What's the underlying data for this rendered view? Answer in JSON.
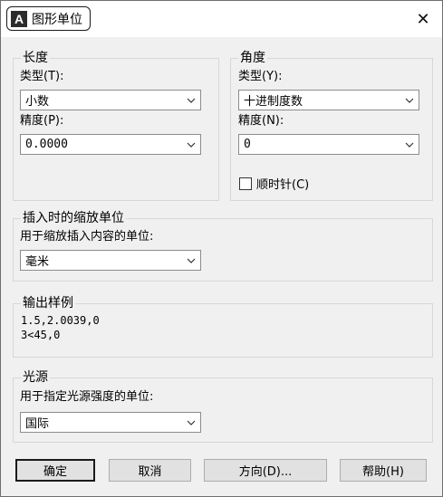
{
  "window": {
    "icon_letter": "A",
    "title": "图形单位",
    "close_symbol": "✕"
  },
  "length": {
    "legend": "长度",
    "type_label": "类型(T):",
    "type_value": "小数",
    "precision_label": "精度(P):",
    "precision_value": "0.0000"
  },
  "angle": {
    "legend": "角度",
    "type_label": "类型(Y):",
    "type_value": "十进制度数",
    "precision_label": "精度(N):",
    "precision_value": "0",
    "clockwise_label": "顺时针(C)",
    "clockwise_checked": false
  },
  "insertion": {
    "legend": "插入时的缩放单位",
    "label": "用于缩放插入内容的单位:",
    "value": "毫米"
  },
  "sample": {
    "legend": "输出样例",
    "line1": "1.5,2.0039,0",
    "line2": "3<45,0"
  },
  "lighting": {
    "legend": "光源",
    "label": "用于指定光源强度的单位:",
    "value": "国际"
  },
  "buttons": {
    "ok": "确定",
    "cancel": "取消",
    "direction": "方向(D)...",
    "help": "帮助(H)"
  },
  "icons": {
    "dropdown": "chevron-down-icon",
    "close": "close-icon",
    "app": "autocad-icon"
  }
}
